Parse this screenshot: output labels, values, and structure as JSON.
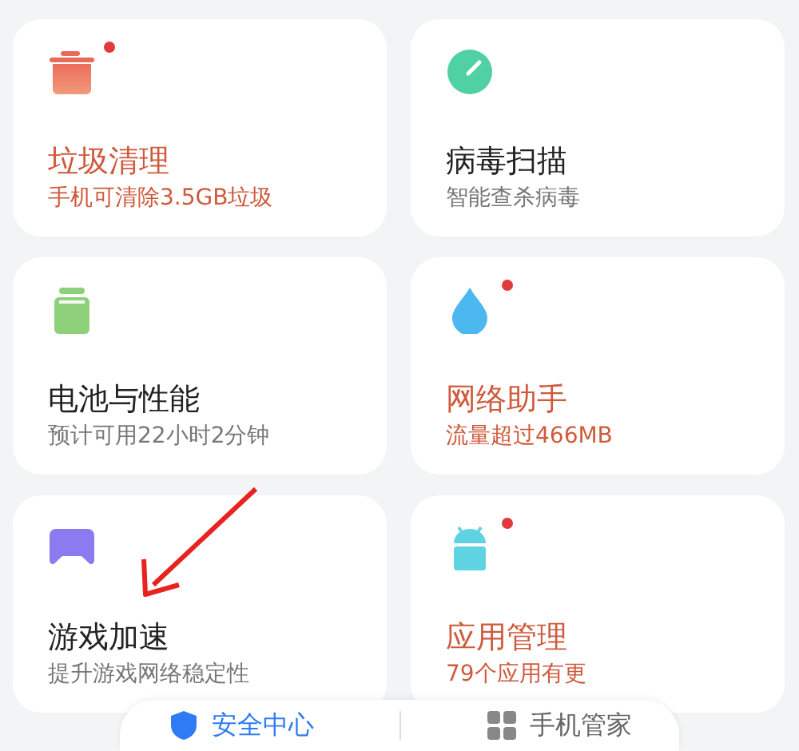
{
  "cards": [
    {
      "title": "垃圾清理",
      "subtitle": "手机可清除3.5GB垃圾",
      "alert": true,
      "badge": true
    },
    {
      "title": "病毒扫描",
      "subtitle": "智能查杀病毒",
      "alert": false,
      "badge": false
    },
    {
      "title": "电池与性能",
      "subtitle": "预计可用22小时2分钟",
      "alert": false,
      "badge": false
    },
    {
      "title": "网络助手",
      "subtitle": "流量超过466MB",
      "alert": true,
      "badge": true
    },
    {
      "title": "游戏加速",
      "subtitle": "提升游戏网络稳定性",
      "alert": false,
      "badge": false
    },
    {
      "title": "应用管理",
      "subtitle": "79个应用有更",
      "alert": true,
      "badge": true
    }
  ],
  "tabs": [
    {
      "label": "安全中心",
      "selected": true
    },
    {
      "label": "手机管家",
      "selected": false
    }
  ]
}
